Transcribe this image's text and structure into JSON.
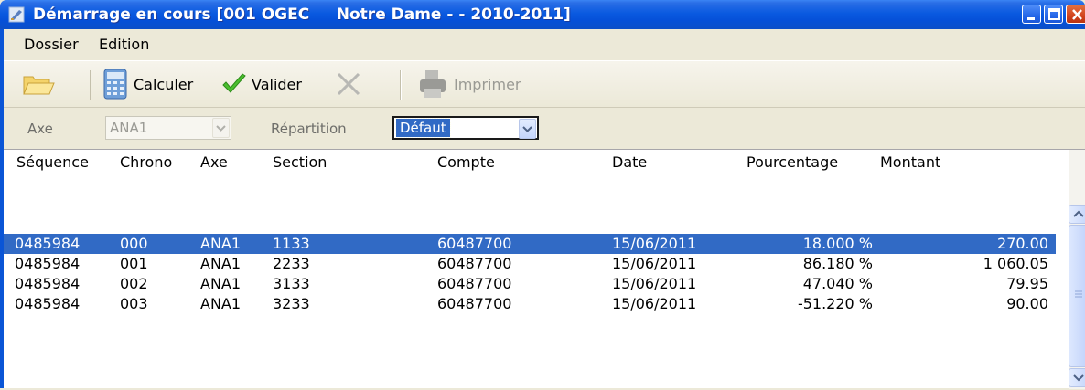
{
  "window": {
    "title": "Démarrage en cours [001 OGEC     Notre Dame - - 2010-2011]",
    "title_color": "#0a55d6"
  },
  "menu": {
    "items": [
      "Dossier",
      "Edition"
    ]
  },
  "toolbar": {
    "open_icon": "folder-open-icon",
    "calculate_label": "Calculer",
    "validate_label": "Valider",
    "print_label": "Imprimer"
  },
  "filters": {
    "axe_label": "Axe",
    "axe_value": "ANA1",
    "repartition_label": "Répartition",
    "repartition_value": "Défaut"
  },
  "table": {
    "columns": [
      "Séquence",
      "Chrono",
      "Axe",
      "Section",
      "Compte",
      "Date",
      "Pourcentage",
      "Montant"
    ],
    "rows": [
      [
        "0485984",
        "000",
        "ANA1",
        "1133",
        "60487700",
        "15/06/2011",
        "18.000 %",
        "270.00"
      ],
      [
        "0485984",
        "001",
        "ANA1",
        "2233",
        "60487700",
        "15/06/2011",
        "86.180 %",
        "1 060.05"
      ],
      [
        "0485984",
        "002",
        "ANA1",
        "3133",
        "60487700",
        "15/06/2011",
        "47.040 %",
        "79.95"
      ],
      [
        "0485984",
        "003",
        "ANA1",
        "3233",
        "60487700",
        "15/06/2011",
        "-51.220 %",
        "90.00"
      ]
    ],
    "selected_row_color": "#316ac5"
  }
}
